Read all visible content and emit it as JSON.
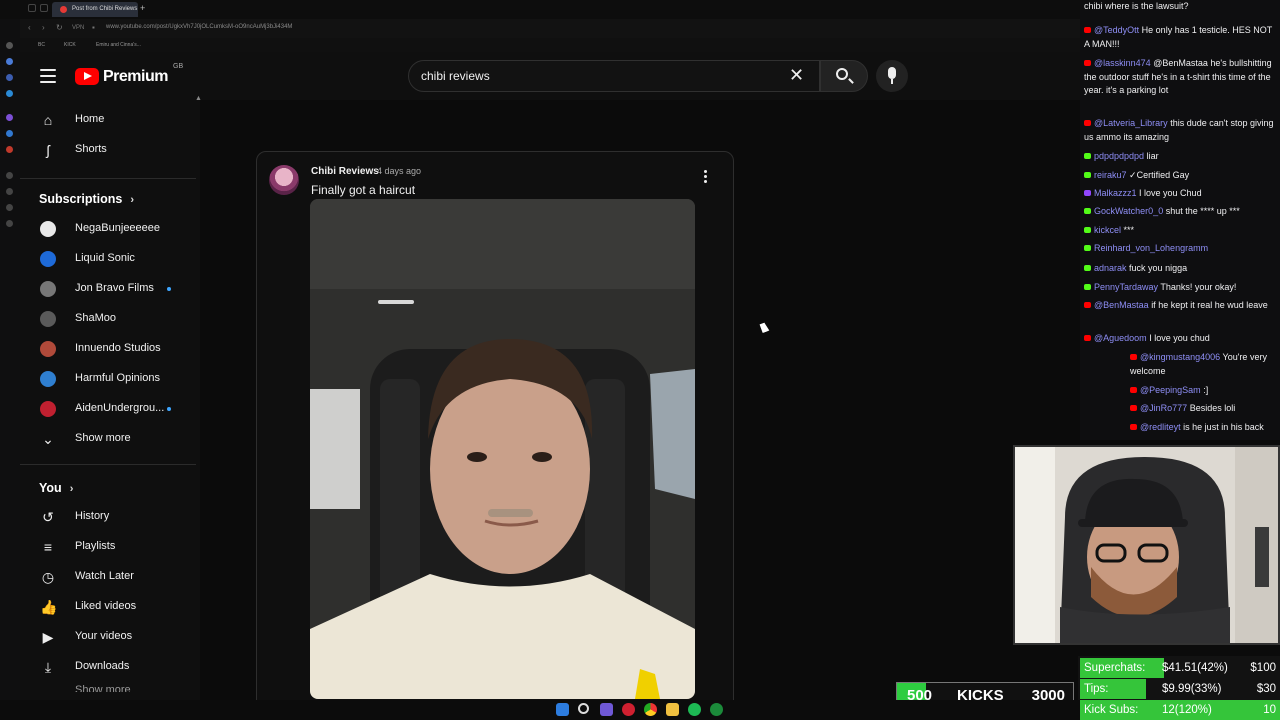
{
  "browser": {
    "tab_title": "Post from Chibi Reviews",
    "url": "www.youtube.com/post/UgkxVh7J0jOLCumksM-oO9ncAuMj3bJi434M",
    "bookmarks": [
      "BC",
      "KICK",
      "Emiru and Cinna's..."
    ]
  },
  "header": {
    "logo_text": "Premium",
    "region": "GB",
    "search_value": "chibi reviews",
    "icons": [
      "menu-icon",
      "clear-icon",
      "search-icon",
      "mic-icon"
    ]
  },
  "guide": {
    "main": [
      {
        "label": "Home",
        "icon": "home-icon"
      },
      {
        "label": "Shorts",
        "icon": "shorts-icon"
      }
    ],
    "subscriptions_title": "Subscriptions",
    "subscriptions": [
      {
        "label": "NegaBunjeeeeee",
        "color": "#e8e8e8",
        "live": false
      },
      {
        "label": "Liquid Sonic",
        "color": "#1e6ad8",
        "live": false
      },
      {
        "label": "Jon Bravo Films",
        "color": "#777777",
        "live": true
      },
      {
        "label": "ShaMoo",
        "color": "#5a5a5a",
        "live": false
      },
      {
        "label": "Innuendo Studios",
        "color": "#b04a3a",
        "live": false
      },
      {
        "label": "Harmful Opinions",
        "color": "#2f7fd0",
        "live": false
      },
      {
        "label": "AidenUndergrou...",
        "color": "#c02030",
        "live": true
      }
    ],
    "show_more": "Show more",
    "you_title": "You",
    "you_items": [
      {
        "label": "History",
        "icon": "history-icon"
      },
      {
        "label": "Playlists",
        "icon": "playlists-icon"
      },
      {
        "label": "Watch Later",
        "icon": "watch-later-icon"
      },
      {
        "label": "Liked videos",
        "icon": "like-icon"
      },
      {
        "label": "Your videos",
        "icon": "your-videos-icon"
      },
      {
        "label": "Downloads",
        "icon": "download-icon"
      }
    ],
    "cut_off_item": "Show more"
  },
  "post": {
    "author": "Chibi Reviews",
    "time": "4 days ago",
    "text": "Finally got a haircut"
  },
  "chat": {
    "messages": [
      {
        "platform": "",
        "user": "",
        "text": "chibi where is the lawsuit?"
      },
      {
        "platform": "youtube",
        "user": "@TeddyOtt",
        "text": "He only has 1 testicle. HES NOT A MAN!!!"
      },
      {
        "platform": "youtube",
        "user": "@lasskinn474",
        "text": "@BenMastaa he's bullshitting the outdoor stuff he's in a t-shirt this time of the year. it's a parking lot"
      },
      {
        "platform": "youtube",
        "user": "@Latveria_Library",
        "text": "this dude can't stop giving us ammo its amazing"
      },
      {
        "platform": "kick",
        "user": "pdpdpdpdpd",
        "text": "liar"
      },
      {
        "platform": "kick",
        "user": "reiraku7",
        "text": "✓Certified Gay"
      },
      {
        "platform": "twitch",
        "user": "Malkazzz1",
        "text": "I love you Chud"
      },
      {
        "platform": "kick",
        "user": "GockWatcher0_0",
        "text": "shut the **** up ***"
      },
      {
        "platform": "kick",
        "user": "kickcel",
        "text": "***"
      },
      {
        "platform": "kick",
        "user": "Reinhard_von_Lohengramm",
        "text": ""
      },
      {
        "platform": "kick",
        "user": "adnarak",
        "text": "fuck you nigga"
      },
      {
        "platform": "kick",
        "user": "PennyTardaway",
        "text": "Thanks! your okay!"
      },
      {
        "platform": "youtube",
        "user": "@BenMastaa",
        "text": "if he kept it real he wud leave"
      },
      {
        "platform": "youtube",
        "user": "@Aguedoom",
        "text": "I love you chud"
      }
    ],
    "replies": [
      {
        "platform": "youtube",
        "user": "@kingmustang4006",
        "text": "You're very welcome"
      },
      {
        "platform": "youtube",
        "user": "@PeepingSam",
        "text": ":]"
      },
      {
        "platform": "youtube",
        "user": "@JinRo777",
        "text": "Besides loli"
      },
      {
        "platform": "youtube",
        "user": "@redliteyt",
        "text": "is he just in his back"
      }
    ],
    "platform_colors": {
      "youtube": "#ff0000",
      "kick": "#53fc18",
      "twitch": "#9146ff"
    }
  },
  "kicks_bar": {
    "current": "500",
    "label": "KICKS",
    "goal": "3000",
    "progress": 0.167
  },
  "goals": [
    {
      "name": "Superchats:",
      "value": "$41.51(42%)",
      "target": "$100",
      "progress": 0.42
    },
    {
      "name": "Tips:",
      "value": "$9.99(33%)",
      "target": "$30",
      "progress": 0.33
    },
    {
      "name": "Kick Subs:",
      "value": "12(120%)",
      "target": "10",
      "progress": 1.0
    }
  ],
  "taskbar": {
    "icons": [
      "windows-icon",
      "search-icon",
      "teams-icon",
      "opera-icon",
      "chrome-icon",
      "files-icon",
      "spotify-icon",
      "xbox-icon"
    ]
  }
}
